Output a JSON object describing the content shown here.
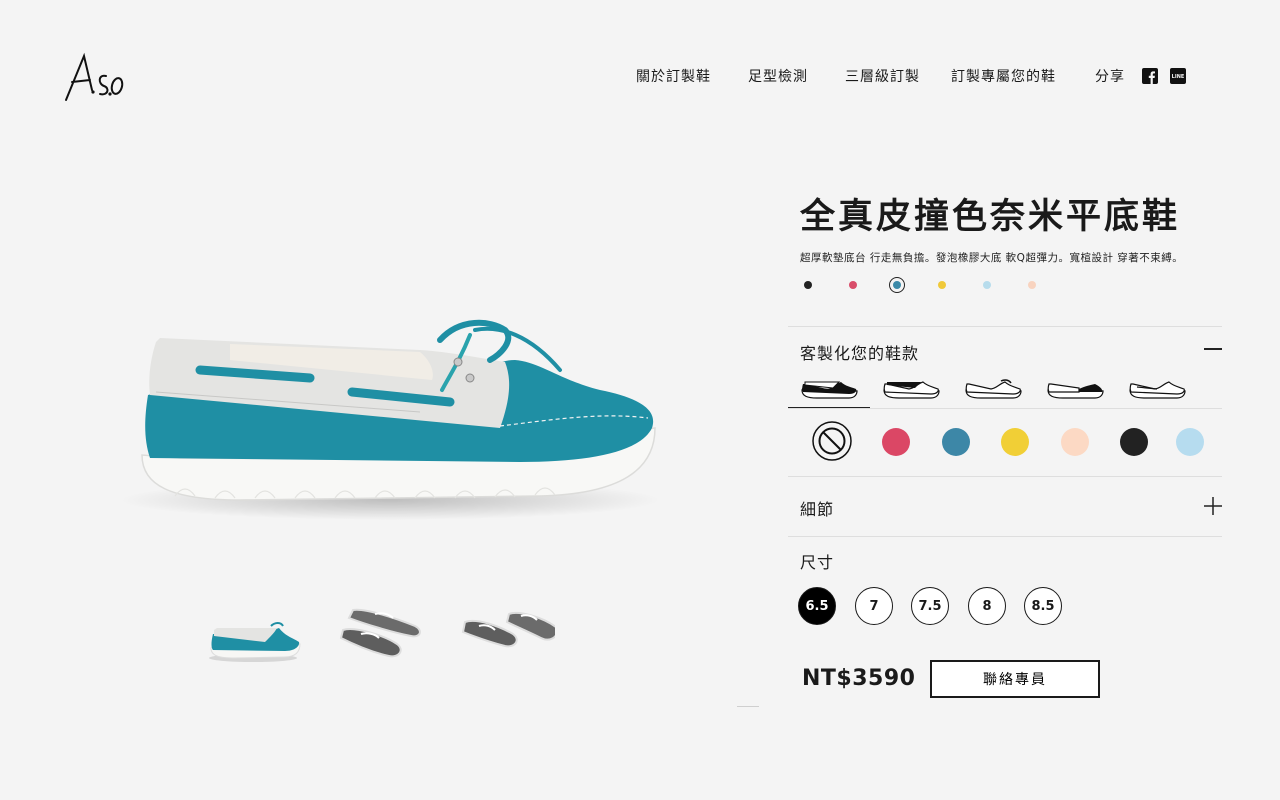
{
  "brand": {
    "logo_text": "A.S.O"
  },
  "nav": {
    "items": [
      "關於訂製鞋",
      "足型檢測",
      "三層級訂製",
      "訂製專屬您的鞋"
    ],
    "share_label": "分享"
  },
  "product": {
    "title": "全真皮撞色奈米平底鞋",
    "description": "超厚軟墊底台 行走無負擔。發泡橡膠大底 軟Q超彈力。寬楦設計 穿著不束縛。",
    "color_swatches": [
      "#222222",
      "#d94d6a",
      "#3c8aa8",
      "#f0c93a",
      "#b7dcec",
      "#f8d3bf"
    ],
    "selected_swatch": 2
  },
  "customize": {
    "title": "客製化您的鞋款",
    "style_count": 5,
    "selected_style": 0,
    "palette": [
      "#db4765",
      "#3d87a7",
      "#f1cf36",
      "#fcd9c4",
      "#222222",
      "#b6dcef"
    ]
  },
  "details": {
    "title": "細節"
  },
  "size": {
    "title": "尺寸",
    "options": [
      "6.5",
      "7",
      "7.5",
      "8",
      "8.5"
    ],
    "selected": "6.5"
  },
  "price": "NT$3590",
  "contact_label": "聯絡專員",
  "colors": {
    "shoe_teal": "#1f8fa4",
    "shoe_white": "#e6e6e4",
    "sole": "#f7f7f5"
  }
}
